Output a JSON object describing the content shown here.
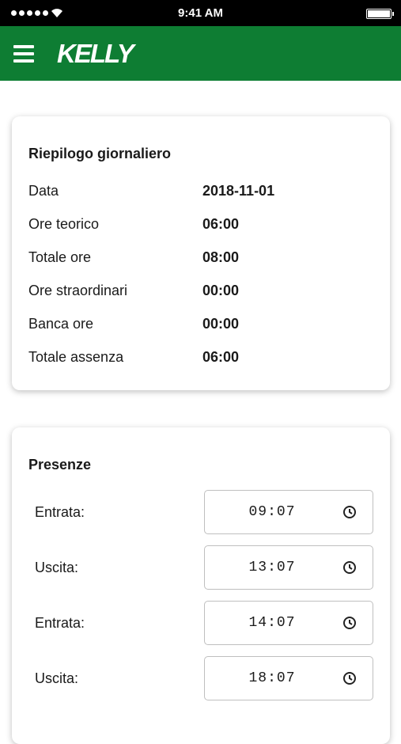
{
  "status_bar": {
    "time": "9:41 AM"
  },
  "header": {
    "logo": "KELLY",
    "menu_icon": "hamburger-menu-icon"
  },
  "summary": {
    "title": "Riepilogo giornaliero",
    "rows": [
      {
        "label": "Data",
        "value": "2018-11-01"
      },
      {
        "label": "Ore teorico",
        "value": "06:00"
      },
      {
        "label": "Totale ore",
        "value": "08:00"
      },
      {
        "label": "Ore straordinari",
        "value": "00:00"
      },
      {
        "label": "Banca ore",
        "value": "00:00"
      },
      {
        "label": "Totale assenza",
        "value": "06:00"
      }
    ]
  },
  "presence": {
    "title": "Presenze",
    "rows": [
      {
        "label": "Entrata:",
        "time": "09:07"
      },
      {
        "label": "Uscita:",
        "time": "13:07"
      },
      {
        "label": "Entrata:",
        "time": "14:07"
      },
      {
        "label": "Uscita:",
        "time": "18:07"
      }
    ]
  },
  "colors": {
    "brand_green": "#0e7d33",
    "status_bar": "#000000"
  }
}
